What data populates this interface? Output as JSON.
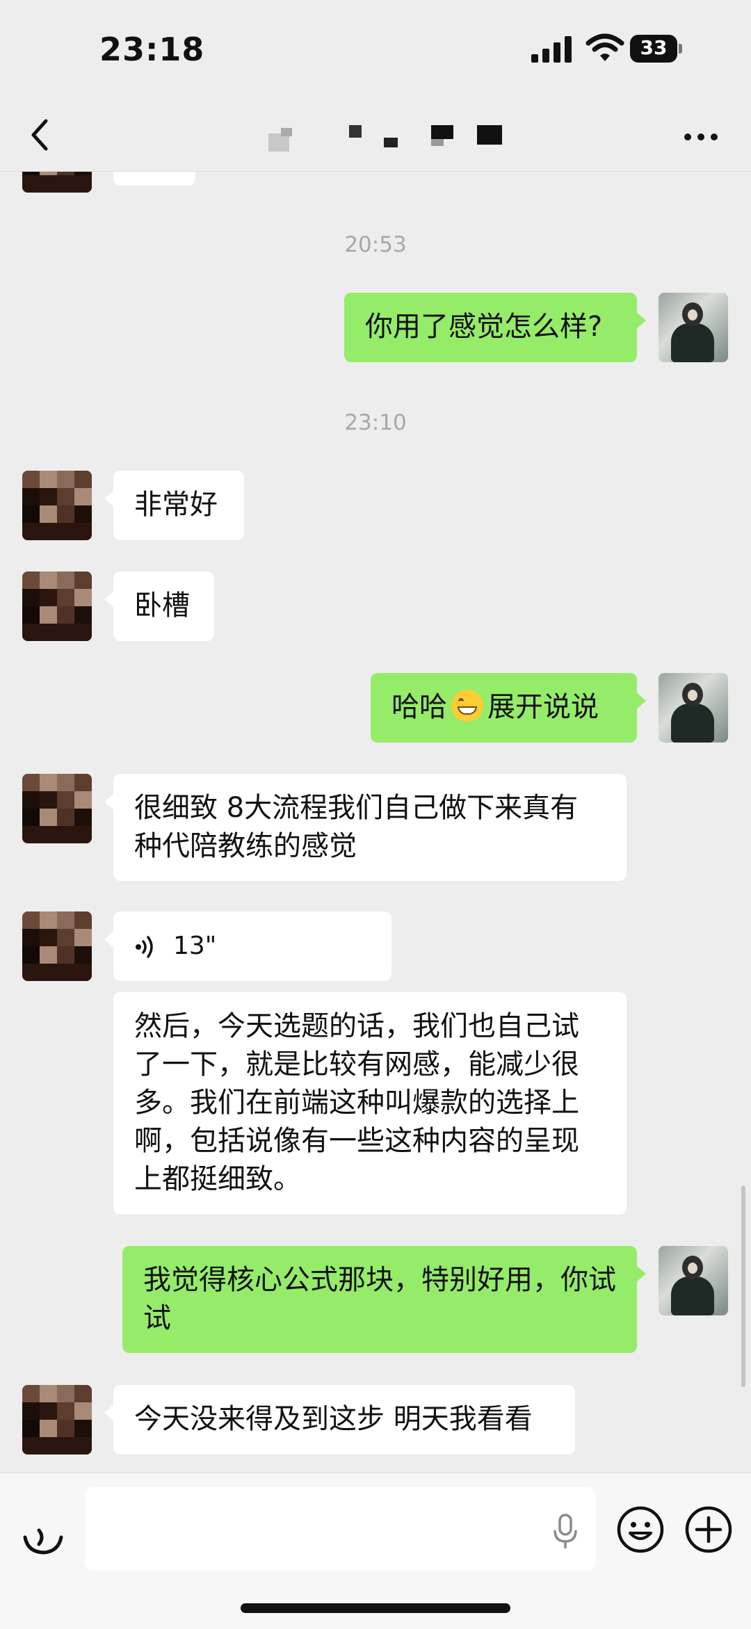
{
  "status_bar": {
    "time": "23:18",
    "battery": "33"
  },
  "nav": {
    "title": ""
  },
  "messages": [
    {
      "type": "timestamp",
      "text": "20:53"
    },
    {
      "type": "text",
      "side": "out",
      "text": "你用了感觉怎么样?"
    },
    {
      "type": "timestamp",
      "text": "23:10"
    },
    {
      "type": "text",
      "side": "in",
      "text": "非常好"
    },
    {
      "type": "text",
      "side": "in",
      "text": "卧槽"
    },
    {
      "type": "text",
      "side": "out",
      "text_before": "哈哈",
      "emoji": "grinning-face",
      "text_after": "展开说说"
    },
    {
      "type": "text",
      "side": "in",
      "text": "很细致 8大流程我们自己做下来真有种代陪教练的感觉"
    },
    {
      "type": "voice",
      "side": "in",
      "duration": "13\""
    },
    {
      "type": "text",
      "side": "in",
      "text": "然后，今天选题的话，我们也自己试了一下，就是比较有网感，能减少很多。我们在前端这种叫爆款的选择上啊，包括说像有一些这种内容的呈现上都挺细致。"
    },
    {
      "type": "text",
      "side": "out",
      "text": "我觉得核心公式那块，特别好用，你试试"
    },
    {
      "type": "text",
      "side": "in",
      "text": "今天没来得及到这步 明天我看看"
    }
  ],
  "input_bar": {
    "placeholder": ""
  },
  "colors": {
    "outgoing_bubble": "#95ec69",
    "incoming_bubble": "#ffffff",
    "background": "#ededed"
  }
}
